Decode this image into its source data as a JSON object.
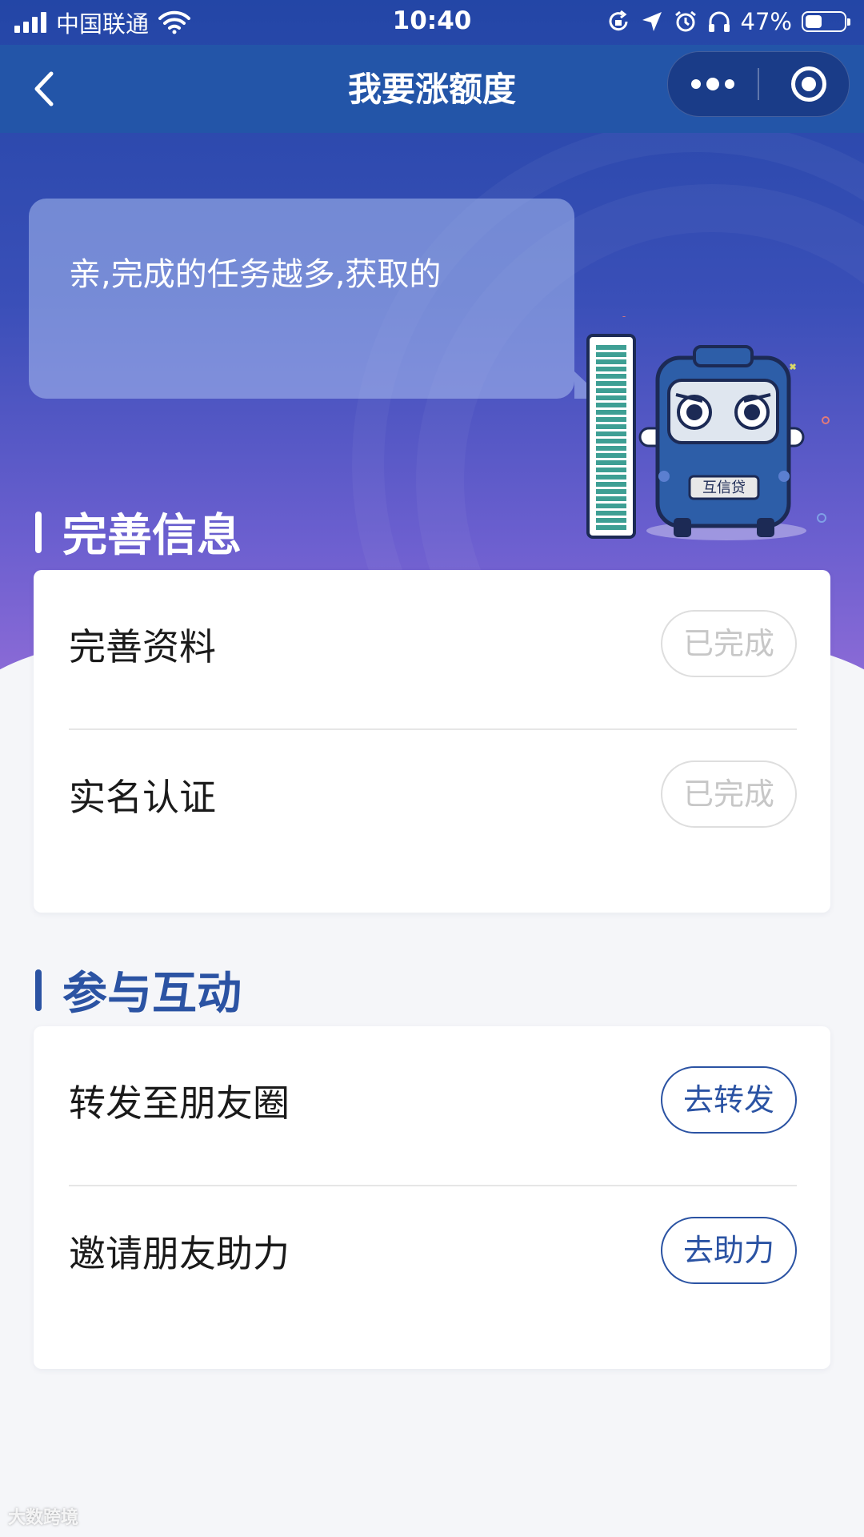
{
  "statusbar": {
    "carrier": "中国联通",
    "time": "10:40",
    "battery_percent": "47%",
    "battery_level": 0.47,
    "icons": [
      "signal-icon",
      "wifi-icon",
      "rotation-lock-icon",
      "location-arrow-icon",
      "alarm-icon",
      "headphones-icon",
      "battery-icon"
    ]
  },
  "navbar": {
    "title": "我要涨额度",
    "back_icon": "chevron-left-icon",
    "more_icon": "more-dots-icon",
    "close_icon": "target-circle-icon"
  },
  "hero": {
    "bubble_text": "亲,完成的任务越多,获取的",
    "mascot_plate": "互信贷"
  },
  "sections": [
    {
      "title": "完善信息",
      "title_color": "#ffffff",
      "bar_color": "#ffffff",
      "items": [
        {
          "label": "完善资料",
          "button": "已完成",
          "status": "done"
        },
        {
          "label": "实名认证",
          "button": "已完成",
          "status": "done"
        }
      ]
    },
    {
      "title": "参与互动",
      "title_color": "#2b53a3",
      "bar_color": "#2b53a3",
      "items": [
        {
          "label": "转发至朋友圈",
          "button": "去转发",
          "status": "todo"
        },
        {
          "label": "邀请朋友助力",
          "button": "去助力",
          "status": "todo"
        }
      ]
    }
  ],
  "watermark": "大数跨境",
  "colors": {
    "navbar": "#2355a8",
    "accent": "#2b53a3",
    "done_button": "#c7c7c7",
    "background": "#f5f6f9"
  }
}
